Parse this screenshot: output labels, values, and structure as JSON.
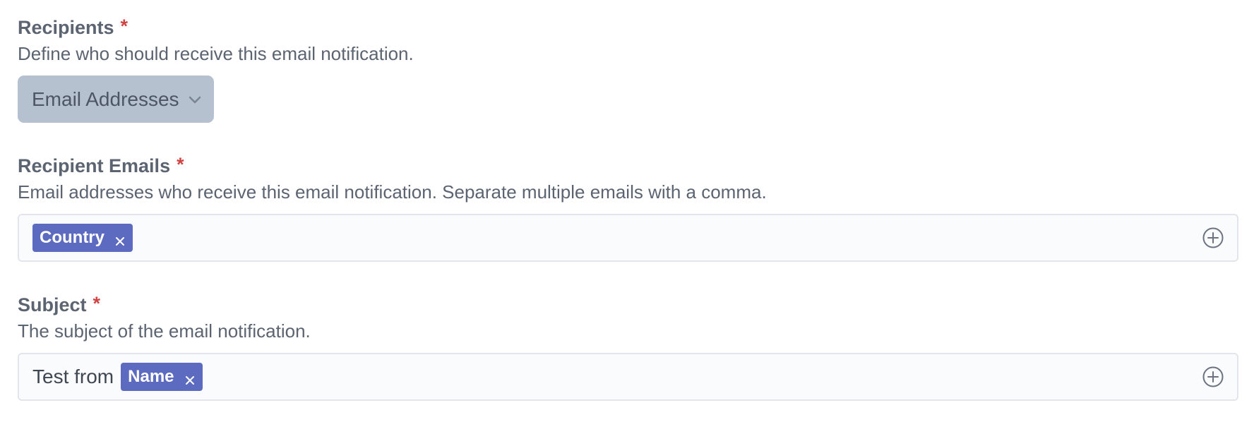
{
  "recipients": {
    "label": "Recipients",
    "required_mark": "*",
    "help": "Define who should receive this email notification.",
    "select_value": "Email Addresses"
  },
  "recipient_emails": {
    "label": "Recipient Emails",
    "required_mark": "*",
    "help": "Email addresses who receive this email notification. Separate multiple emails with a comma.",
    "tags": [
      "Country"
    ]
  },
  "subject": {
    "label": "Subject",
    "required_mark": "*",
    "help": "The subject of the email notification.",
    "text": "Test from",
    "tags": [
      "Name"
    ]
  },
  "icons": {
    "select_chevron": "chevron-down-icon",
    "tag_remove": "close-icon",
    "add_field": "plus-circle-icon"
  },
  "colors": {
    "tag_background": "#5c6bc0",
    "required": "#d14343",
    "select_background": "#b6c1d0"
  }
}
